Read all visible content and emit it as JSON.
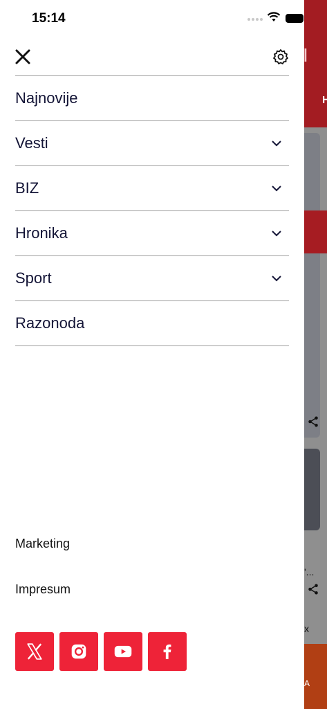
{
  "status_bar": {
    "time": "15:14"
  },
  "menu": {
    "items": [
      {
        "label": "Najnovije",
        "expandable": false
      },
      {
        "label": "Vesti",
        "expandable": true
      },
      {
        "label": "BIZ",
        "expandable": true
      },
      {
        "label": "Hronika",
        "expandable": true
      },
      {
        "label": "Sport",
        "expandable": true
      },
      {
        "label": "Razonoda",
        "expandable": false
      }
    ]
  },
  "footer": {
    "links": [
      "Marketing",
      "Impresum"
    ]
  },
  "social": [
    {
      "icon": "x-icon"
    },
    {
      "icon": "instagram-icon"
    },
    {
      "icon": "youtube-icon"
    },
    {
      "icon": "facebook-icon"
    }
  ],
  "background": {
    "header_letter": "H",
    "footer_letter": "A",
    "snippet_text": "'...",
    "snippet_text_2": "x"
  },
  "colors": {
    "social_red": "#ee2338",
    "menu_text": "#131436",
    "divider": "#9e9e9e",
    "bg_header_red": "#a31c22"
  }
}
